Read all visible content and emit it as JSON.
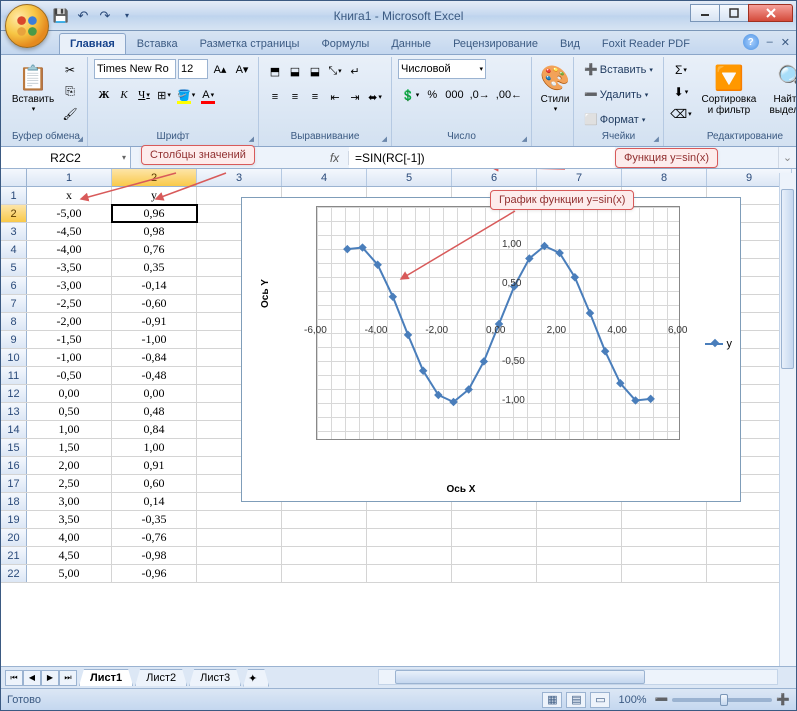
{
  "app": {
    "title": "Книга1 - Microsoft Excel"
  },
  "tabs": [
    "Главная",
    "Вставка",
    "Разметка страницы",
    "Формулы",
    "Данные",
    "Рецензирование",
    "Вид",
    "Foxit Reader PDF"
  ],
  "ribbon": {
    "clipboard": {
      "label": "Буфер обмена",
      "paste": "Вставить"
    },
    "font": {
      "label": "Шрифт",
      "name": "Times New Ro",
      "size": "12"
    },
    "alignment": {
      "label": "Выравнивание"
    },
    "number": {
      "label": "Число",
      "format": "Числовой"
    },
    "styles": {
      "label": "Стили"
    },
    "cells": {
      "label": "Ячейки",
      "insert": "Вставить",
      "delete": "Удалить",
      "format": "Формат"
    },
    "editing": {
      "label": "Редактирование",
      "sort": "Сортировка и фильтр",
      "find": "Найти и выделить"
    }
  },
  "formula_bar": {
    "name_box": "R2C2",
    "formula": "=SIN(RC[-1])"
  },
  "callouts": {
    "columns": "Столбцы значений",
    "function": "Функция y=sin(x)",
    "chart": "График функции y=sin(x)"
  },
  "col_headers": [
    "1",
    "2",
    "3",
    "4",
    "5",
    "6",
    "7",
    "8",
    "9"
  ],
  "table": {
    "header": [
      "x",
      "y"
    ],
    "rows": [
      [
        "-5,00",
        "0,96"
      ],
      [
        "-4,50",
        "0,98"
      ],
      [
        "-4,00",
        "0,76"
      ],
      [
        "-3,50",
        "0,35"
      ],
      [
        "-3,00",
        "-0,14"
      ],
      [
        "-2,50",
        "-0,60"
      ],
      [
        "-2,00",
        "-0,91"
      ],
      [
        "-1,50",
        "-1,00"
      ],
      [
        "-1,00",
        "-0,84"
      ],
      [
        "-0,50",
        "-0,48"
      ],
      [
        "0,00",
        "0,00"
      ],
      [
        "0,50",
        "0,48"
      ],
      [
        "1,00",
        "0,84"
      ],
      [
        "1,50",
        "1,00"
      ],
      [
        "2,00",
        "0,91"
      ],
      [
        "2,50",
        "0,60"
      ],
      [
        "3,00",
        "0,14"
      ],
      [
        "3,50",
        "-0,35"
      ],
      [
        "4,00",
        "-0,76"
      ],
      [
        "4,50",
        "-0,98"
      ],
      [
        "5,00",
        "-0,96"
      ]
    ]
  },
  "chart_data": {
    "type": "line",
    "x": [
      -5,
      -4.5,
      -4,
      -3.5,
      -3,
      -2.5,
      -2,
      -1.5,
      -1,
      -0.5,
      0,
      0.5,
      1,
      1.5,
      2,
      2.5,
      3,
      3.5,
      4,
      4.5,
      5
    ],
    "series": [
      {
        "name": "y",
        "values": [
          0.96,
          0.98,
          0.76,
          0.35,
          -0.14,
          -0.6,
          -0.91,
          -1.0,
          -0.84,
          -0.48,
          0.0,
          0.48,
          0.84,
          1.0,
          0.91,
          0.6,
          0.14,
          -0.35,
          -0.76,
          -0.98,
          -0.96
        ]
      }
    ],
    "xlabel": "Ось X",
    "ylabel": "Ось Y",
    "xlim": [
      -6,
      6
    ],
    "ylim": [
      -1.5,
      1.5
    ],
    "xticks": [
      -6,
      -4,
      -2,
      0,
      2,
      4,
      6
    ],
    "yticks": [
      -1.5,
      -1.0,
      -0.5,
      0.0,
      0.5,
      1.0,
      1.5
    ],
    "legend": "y"
  },
  "sheets": [
    "Лист1",
    "Лист2",
    "Лист3"
  ],
  "status": {
    "ready": "Готово",
    "zoom": "100%"
  }
}
